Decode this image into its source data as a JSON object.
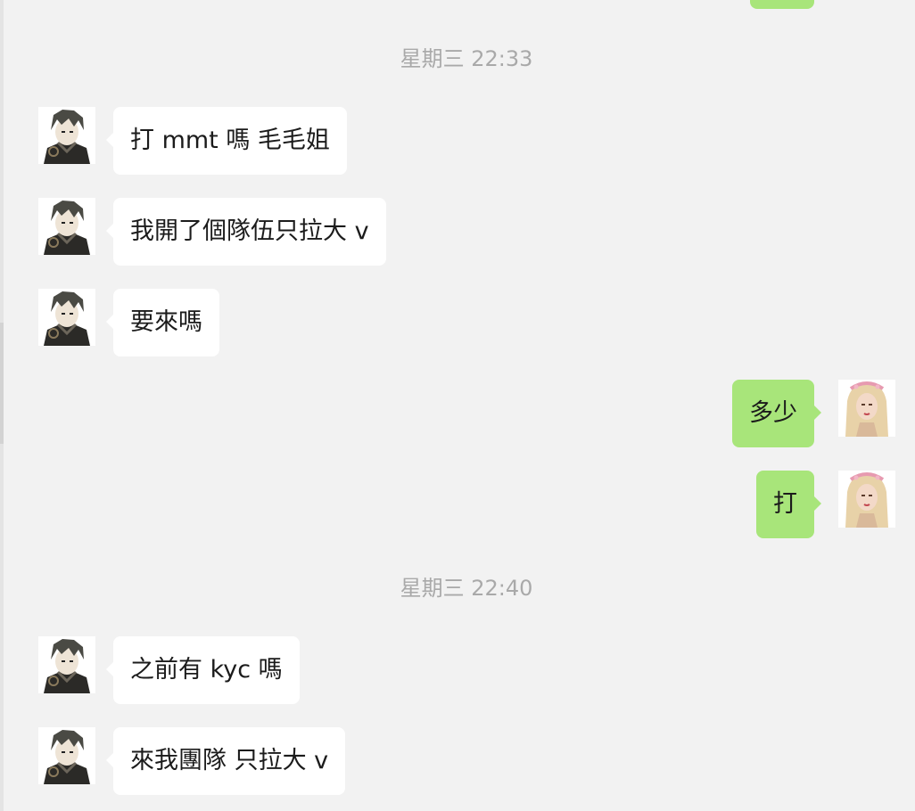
{
  "chat": {
    "colors": {
      "background": "#f2f2f2",
      "incoming_bubble": "#ffffff",
      "outgoing_bubble": "#a8e57a",
      "timestamp": "#a9a9a9"
    },
    "timestamps": [
      "星期三 22:33",
      "星期三 22:40"
    ],
    "messages": [
      {
        "direction": "incoming",
        "avatar": "anime-boy-avatar",
        "text": "打 mmt 嗎  毛毛姐"
      },
      {
        "direction": "incoming",
        "avatar": "anime-boy-avatar",
        "text": "我開了個隊伍只拉大 v"
      },
      {
        "direction": "incoming",
        "avatar": "anime-boy-avatar",
        "text": "要來嗎"
      },
      {
        "direction": "outgoing",
        "avatar": "blonde-woman-avatar",
        "text": "多少"
      },
      {
        "direction": "outgoing",
        "avatar": "blonde-woman-avatar",
        "text": "打"
      },
      {
        "direction": "incoming",
        "avatar": "anime-boy-avatar",
        "text": "之前有 kyc 嗎"
      },
      {
        "direction": "incoming",
        "avatar": "anime-boy-avatar",
        "text": "來我團隊  只拉大 v"
      }
    ]
  }
}
